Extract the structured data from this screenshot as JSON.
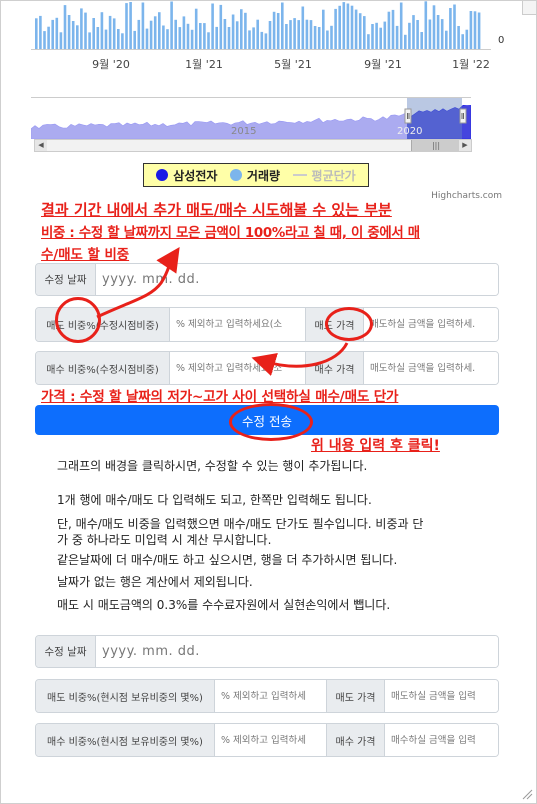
{
  "chart": {
    "x_labels": [
      "9월 '20",
      "1월 '21",
      "5월 '21",
      "9월 '21",
      "1월 '22"
    ],
    "y_axis_zero": "0",
    "navigator_years": [
      "2015",
      "2020"
    ],
    "legend": [
      "삼성전자",
      "거래량",
      "평균단가"
    ],
    "legend_colors": [
      "#1a1ae6",
      "#7cb5ec",
      "#cccccc"
    ],
    "credits": "Highcharts.com"
  },
  "annotations": {
    "title": "결과 기간 내에서 추가 매도/매수 시도해볼 수 있는 부분",
    "ratio_note_line1": "비중 : 수정 할 날짜까지 모은 금액이 100%라고 칠 때, 이 중에서 매",
    "ratio_note_line2": "수/매도 할 비중",
    "price_note": "가격 : 수정 할 날짜의 저가~고가 사이 선택하실 매수/매도 단가",
    "click_note": "위 내용 입력 후 클릭!"
  },
  "form_top": {
    "date_label": "수정 날짜",
    "date_placeholder": "yyyy. mm. dd.",
    "sell_ratio_label": "매도 비중%(수정시점비중)",
    "sell_ratio_placeholder": "% 제외하고 입력하세요(소",
    "sell_price_label": "매도 가격",
    "sell_price_placeholder": "매도하실 금액을 입력하세.",
    "buy_ratio_label": "매수 비중%(수정시점비중)",
    "buy_ratio_placeholder": "% 제외하고 입력하세요(소",
    "buy_price_label": "매수 가격",
    "buy_price_placeholder": "매도하실 금액을 입력하세."
  },
  "submit_label": "수정 전송",
  "info_lines": [
    "그래프의 배경을 클릭하시면, 수정할 수 있는 행이 추가됩니다.",
    "1개 행에 매수/매도 다 입력해도 되고, 한쪽만 입력해도 됩니다.",
    "단, 매수/매도 비중을 입력했으면 매수/매도 단가도 필수입니다. 비중과 단",
    "가 중 하나라도 미입력 시 계산 무시합니다.",
    "같은날짜에 더 매수/매도 하고 싶으시면, 행을 더 추가하시면 됩니다.",
    "날짜가 없는 행은 계산에서 제외됩니다.",
    "매도 시 매도금액의 0.3%를 수수료자원에서 실현손익에서 뺍니다."
  ],
  "form_bottom": {
    "date_label": "수정 날짜",
    "date_placeholder": "yyyy. mm. dd.",
    "sell_ratio_label": "매도 비중%(현시점 보유비중의 몇%)",
    "sell_ratio_placeholder": "% 제외하고 입력하세",
    "sell_price_label": "매도 가격",
    "sell_price_placeholder": "매도하실 금액을 입력",
    "buy_ratio_label": "매수 비중%(현시점 보유비중의 몇%)",
    "buy_ratio_placeholder": "% 제외하고 입력하세",
    "buy_price_label": "매수 가격",
    "buy_price_placeholder": "매수하실 금액을 입력"
  }
}
